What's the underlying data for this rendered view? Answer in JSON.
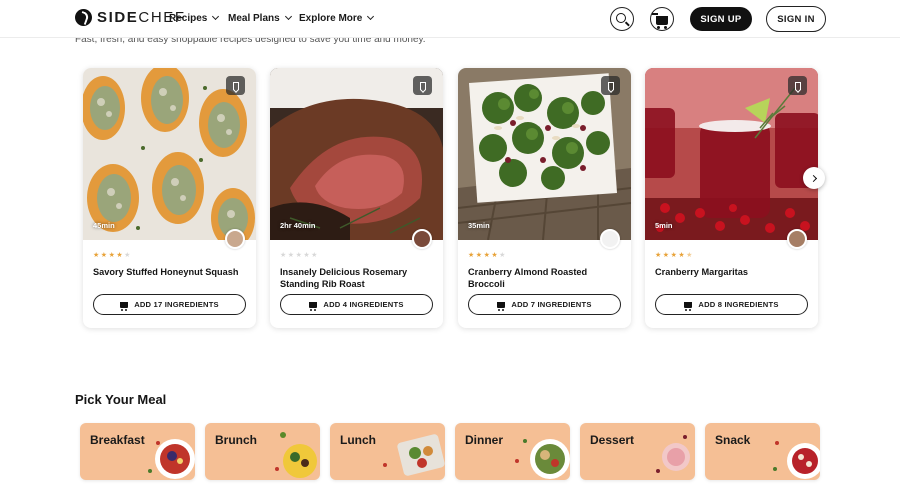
{
  "brand": {
    "logo_bold": "SIDE",
    "logo_light": "CHEF"
  },
  "nav": {
    "items": [
      {
        "label": "Recipes"
      },
      {
        "label": "Meal Plans"
      },
      {
        "label": "Explore More"
      }
    ],
    "signup_label": "SIGN UP",
    "signin_label": "SIGN IN"
  },
  "hero": {
    "subtitle": "Fast, fresh, and easy shoppable recipes designed to save you time and money."
  },
  "recipes": [
    {
      "title": "Savory Stuffed Honeynut Squash",
      "time": "45min",
      "rating": 4,
      "button": "ADD 17 INGREDIENTS"
    },
    {
      "title": "Insanely Delicious Rosemary Standing Rib Roast",
      "time": "2hr 40min",
      "rating": 0,
      "button": "ADD 4 INGREDIENTS"
    },
    {
      "title": "Cranberry Almond Roasted Broccoli",
      "time": "35min",
      "rating": 4,
      "button": "ADD 7 INGREDIENTS"
    },
    {
      "title": "Cranberry Margaritas",
      "time": "5min",
      "rating": 4.5,
      "button": "ADD 8 INGREDIENTS"
    }
  ],
  "meals": {
    "title": "Pick Your Meal",
    "items": [
      {
        "label": "Breakfast"
      },
      {
        "label": "Brunch"
      },
      {
        "label": "Lunch"
      },
      {
        "label": "Dinner"
      },
      {
        "label": "Dessert"
      },
      {
        "label": "Snack"
      }
    ]
  },
  "colors": {
    "accent": "#111111",
    "star": "#e8a33a",
    "meal_bg": "#f5bf95"
  }
}
